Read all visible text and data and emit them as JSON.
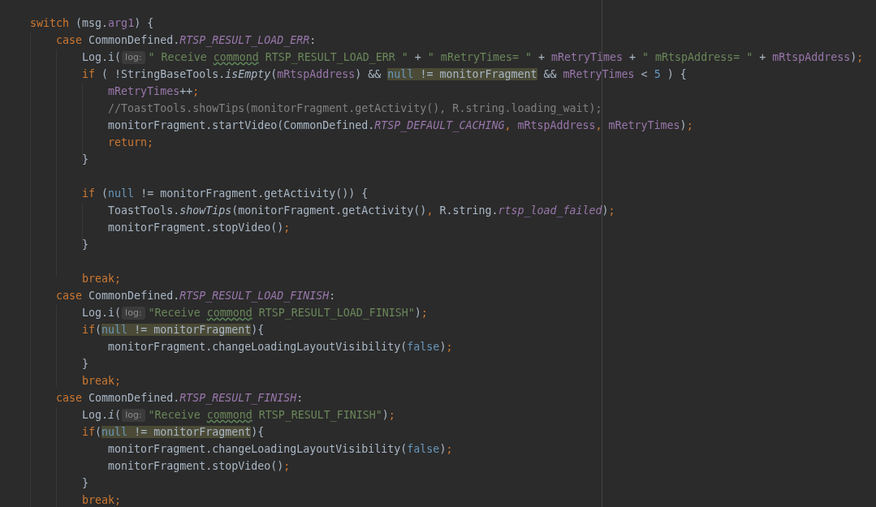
{
  "code_lines": [
    [
      {
        "kind": "keyword",
        "text": "    switch"
      },
      {
        "kind": "plain",
        "text": " (msg."
      },
      {
        "kind": "field",
        "text": "arg1"
      },
      {
        "kind": "plain",
        "text": ") {"
      }
    ],
    [
      {
        "kind": "keyword",
        "text": "        case"
      },
      {
        "kind": "plain",
        "text": " CommonDefined."
      },
      {
        "kind": "constant",
        "text": "RTSP_RESULT_LOAD_ERR"
      },
      {
        "kind": "plain",
        "text": ":"
      }
    ],
    [
      {
        "kind": "plain",
        "text": "            Log.i("
      },
      {
        "kind": "hint",
        "text": "log:"
      },
      {
        "kind": "string",
        "text": "\" Receive "
      },
      {
        "kind": "misspelled",
        "text": "commond"
      },
      {
        "kind": "string",
        "text": " RTSP_RESULT_LOAD_ERR \""
      },
      {
        "kind": "plain",
        "text": " + "
      },
      {
        "kind": "string",
        "text": "\" mRetryTimes= \""
      },
      {
        "kind": "plain",
        "text": " + "
      },
      {
        "kind": "field",
        "text": "mRetryTimes"
      },
      {
        "kind": "plain",
        "text": " + "
      },
      {
        "kind": "string",
        "text": "\" mRtspAddress= \""
      },
      {
        "kind": "plain",
        "text": " + "
      },
      {
        "kind": "field",
        "text": "mRtspAddress"
      },
      {
        "kind": "plain",
        "text": ")"
      },
      {
        "kind": "keyword",
        "text": ";"
      }
    ],
    [
      {
        "kind": "keyword",
        "text": "            if"
      },
      {
        "kind": "plain",
        "text": " ( !StringBaseTools."
      },
      {
        "kind": "italic",
        "text": "isEmpty"
      },
      {
        "kind": "plain",
        "text": "("
      },
      {
        "kind": "field",
        "text": "mRtspAddress"
      },
      {
        "kind": "plain",
        "text": ") && "
      },
      {
        "kind": "highlight",
        "children": [
          {
            "kind": "literal",
            "text": "null"
          },
          {
            "kind": "plain",
            "text": " != monitorFragment"
          }
        ]
      },
      {
        "kind": "plain",
        "text": " && "
      },
      {
        "kind": "field",
        "text": "mRetryTimes"
      },
      {
        "kind": "plain",
        "text": " < "
      },
      {
        "kind": "number",
        "text": "5"
      },
      {
        "kind": "plain",
        "text": " ) {"
      }
    ],
    [
      {
        "kind": "field",
        "text": "                mRetryTimes"
      },
      {
        "kind": "plain",
        "text": "++"
      },
      {
        "kind": "keyword",
        "text": ";"
      }
    ],
    [
      {
        "kind": "comment",
        "text": "                //ToastTools.showTips(monitorFragment.getActivity(), R.string.loading_wait);"
      }
    ],
    [
      {
        "kind": "plain",
        "text": "                monitorFragment.startVideo(CommonDefined."
      },
      {
        "kind": "constant",
        "text": "RTSP_DEFAULT_CACHING"
      },
      {
        "kind": "keyword",
        "text": ","
      },
      {
        "kind": "field",
        "text": " mRtspAddress"
      },
      {
        "kind": "keyword",
        "text": ","
      },
      {
        "kind": "field",
        "text": " mRetryTimes"
      },
      {
        "kind": "plain",
        "text": ")"
      },
      {
        "kind": "keyword",
        "text": ";"
      }
    ],
    [
      {
        "kind": "keyword",
        "text": "                return;"
      }
    ],
    [
      {
        "kind": "plain",
        "text": "            }"
      }
    ],
    [
      {
        "kind": "blank"
      }
    ],
    [
      {
        "kind": "keyword",
        "text": "            if"
      },
      {
        "kind": "plain",
        "text": " ("
      },
      {
        "kind": "literal",
        "text": "null"
      },
      {
        "kind": "plain",
        "text": " != monitorFragment.getActivity()) {"
      }
    ],
    [
      {
        "kind": "plain",
        "text": "                ToastTools."
      },
      {
        "kind": "italic",
        "text": "showTips"
      },
      {
        "kind": "plain",
        "text": "(monitorFragment.getActivity()"
      },
      {
        "kind": "keyword",
        "text": ","
      },
      {
        "kind": "plain",
        "text": " R.string."
      },
      {
        "kind": "constant",
        "text": "rtsp_load_failed"
      },
      {
        "kind": "plain",
        "text": ")"
      },
      {
        "kind": "keyword",
        "text": ";"
      }
    ],
    [
      {
        "kind": "plain",
        "text": "                monitorFragment.stopVideo()"
      },
      {
        "kind": "keyword",
        "text": ";"
      }
    ],
    [
      {
        "kind": "plain",
        "text": "            }"
      }
    ],
    [
      {
        "kind": "blank"
      }
    ],
    [
      {
        "kind": "keyword",
        "text": "            break;"
      }
    ],
    [
      {
        "kind": "keyword",
        "text": "        case"
      },
      {
        "kind": "plain",
        "text": " CommonDefined."
      },
      {
        "kind": "constant",
        "text": "RTSP_RESULT_LOAD_FINISH"
      },
      {
        "kind": "plain",
        "text": ":"
      }
    ],
    [
      {
        "kind": "plain",
        "text": "            Log.i("
      },
      {
        "kind": "hint",
        "text": "log:"
      },
      {
        "kind": "string",
        "text": "\"Receive "
      },
      {
        "kind": "misspelled",
        "text": "commond"
      },
      {
        "kind": "string",
        "text": " RTSP_RESULT_LOAD_FINISH\""
      },
      {
        "kind": "plain",
        "text": ")"
      },
      {
        "kind": "keyword",
        "text": ";"
      }
    ],
    [
      {
        "kind": "keyword",
        "text": "            if"
      },
      {
        "kind": "plain",
        "text": "("
      },
      {
        "kind": "highlight",
        "children": [
          {
            "kind": "literal",
            "text": "null"
          },
          {
            "kind": "plain",
            "text": " != monitorFragment"
          }
        ]
      },
      {
        "kind": "plain",
        "text": "){"
      }
    ],
    [
      {
        "kind": "plain",
        "text": "                monitorFragment.changeLoadingLayoutVisibility("
      },
      {
        "kind": "literal",
        "text": "false"
      },
      {
        "kind": "plain",
        "text": ")"
      },
      {
        "kind": "keyword",
        "text": ";"
      }
    ],
    [
      {
        "kind": "plain",
        "text": "            }"
      }
    ],
    [
      {
        "kind": "keyword",
        "text": "            break;"
      }
    ],
    [
      {
        "kind": "keyword",
        "text": "        case"
      },
      {
        "kind": "plain",
        "text": " CommonDefined."
      },
      {
        "kind": "constant",
        "text": "RTSP_RESULT_FINISH"
      },
      {
        "kind": "plain",
        "text": ":"
      }
    ],
    [
      {
        "kind": "plain",
        "text": "            Log."
      },
      {
        "kind": "italic",
        "text": "i"
      },
      {
        "kind": "plain",
        "text": "("
      },
      {
        "kind": "hint",
        "text": "log:"
      },
      {
        "kind": "string",
        "text": "\"Receive "
      },
      {
        "kind": "misspelled",
        "text": "commond"
      },
      {
        "kind": "string",
        "text": " RTSP_RESULT_FINISH\""
      },
      {
        "kind": "plain",
        "text": ")"
      },
      {
        "kind": "keyword",
        "text": ";"
      }
    ],
    [
      {
        "kind": "keyword",
        "text": "            if"
      },
      {
        "kind": "plain",
        "text": "("
      },
      {
        "kind": "highlight",
        "children": [
          {
            "kind": "literal",
            "text": "null"
          },
          {
            "kind": "plain",
            "text": " != monitorFragment"
          }
        ]
      },
      {
        "kind": "plain",
        "text": "){"
      }
    ],
    [
      {
        "kind": "plain",
        "text": "                monitorFragment.changeLoadingLayoutVisibility("
      },
      {
        "kind": "literal",
        "text": "false"
      },
      {
        "kind": "plain",
        "text": ")"
      },
      {
        "kind": "keyword",
        "text": ";"
      }
    ],
    [
      {
        "kind": "plain",
        "text": "                monitorFragment.stopVideo()"
      },
      {
        "kind": "keyword",
        "text": ";"
      }
    ],
    [
      {
        "kind": "plain",
        "text": "            }"
      }
    ],
    [
      {
        "kind": "keyword",
        "text": "            break;"
      }
    ]
  ]
}
